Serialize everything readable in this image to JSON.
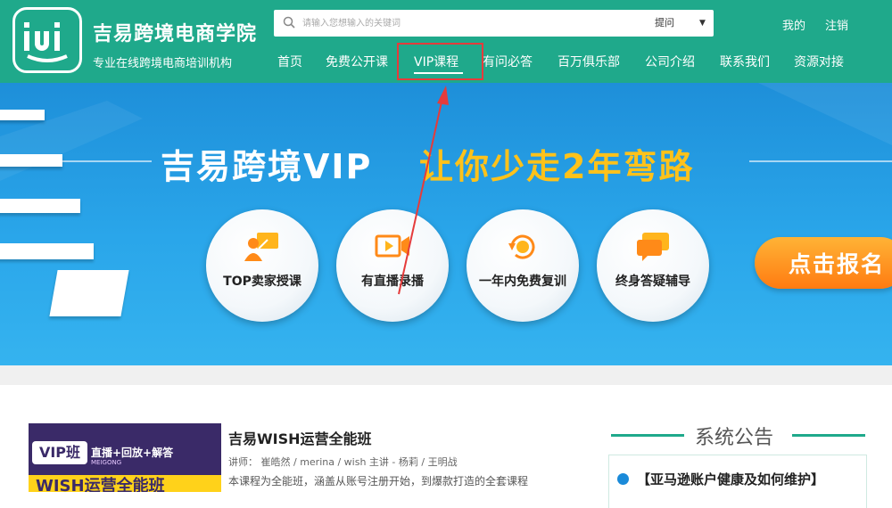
{
  "brand": {
    "name": "吉易跨境电商学院",
    "slogan": "专业在线跨境电商培训机构",
    "logo_text": "JYJ"
  },
  "search": {
    "placeholder": "请输入您想输入的关键词",
    "select_value": "提问",
    "select_arrow": "▼"
  },
  "top_links": [
    "我的",
    "注销"
  ],
  "nav": [
    "首页",
    "免费公开课",
    "VIP课程",
    "有问必答",
    "百万俱乐部",
    "公司介绍",
    "联系我们",
    "资源对接"
  ],
  "banner": {
    "title_white": "吉易跨境VIP",
    "title_yellow": "让你少走2年弯路",
    "features": [
      "TOP卖家授课",
      "有直播录播",
      "一年内免费复训",
      "终身答疑辅导"
    ],
    "signup_label": "点击报名"
  },
  "course": {
    "thumb_badge": "VIP班",
    "thumb_tag": "直播+回放+解答",
    "thumb_brand": "MEIGONG",
    "thumb_big": "WISH运营全能班",
    "title": "吉易WISH运营全能班",
    "meta": "讲师：  崔皓然 / merina / wish 主讲 - 杨莉 / 王明战",
    "desc": "本课程为全能班，涵盖从账号注册开始，到爆款打造的全套课程"
  },
  "notice": {
    "heading": "系统公告",
    "item": "【亚马逊账户健康及如何维护】"
  },
  "colors": {
    "header_green": "#1fa98b",
    "highlight_red": "#e53b3b",
    "banner_blue": "#2aa6ea",
    "accent_yellow": "#ffc21a",
    "signup_orange": "#ff8a18"
  }
}
